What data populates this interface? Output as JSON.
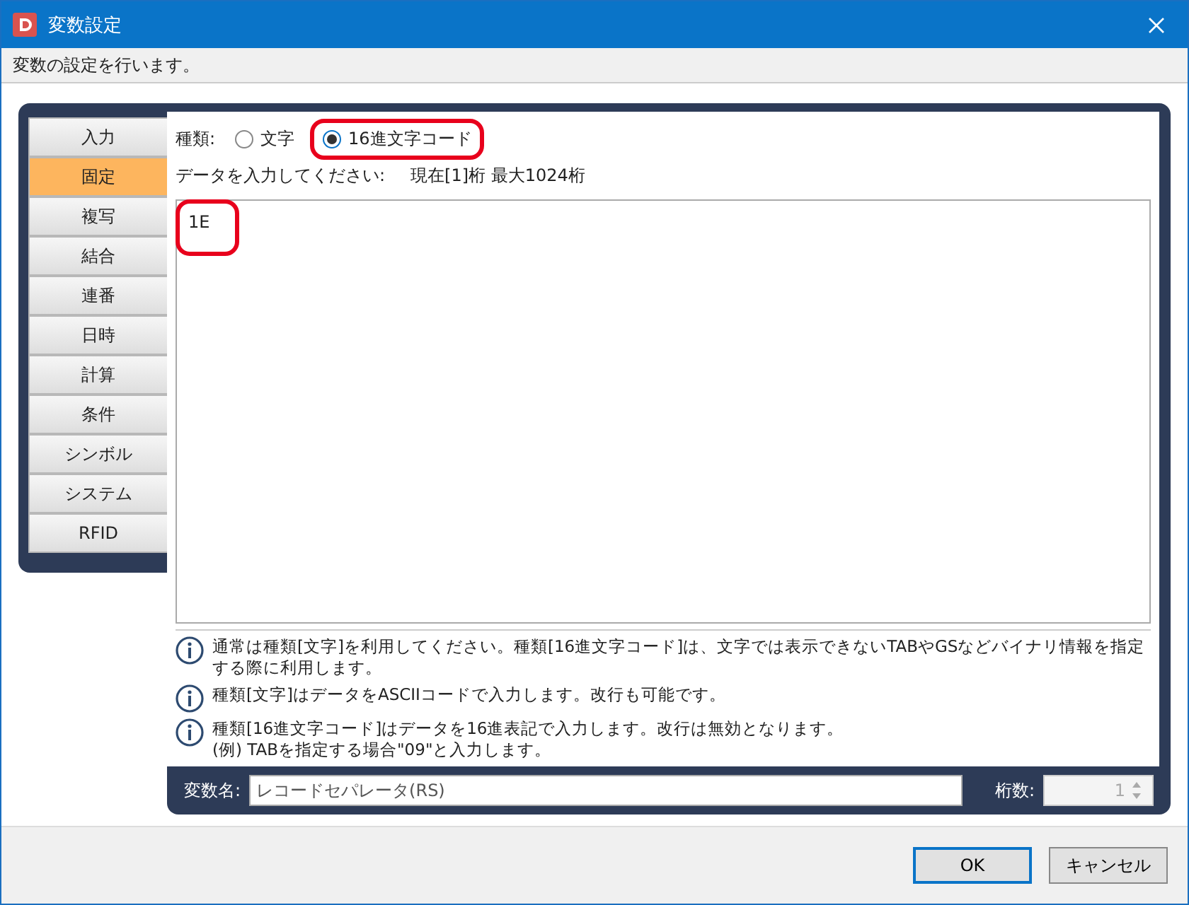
{
  "window": {
    "title": "変数設定",
    "description": "変数の設定を行います。"
  },
  "tabs": [
    {
      "label": "入力",
      "selected": false
    },
    {
      "label": "固定",
      "selected": true
    },
    {
      "label": "複写",
      "selected": false
    },
    {
      "label": "結合",
      "selected": false
    },
    {
      "label": "連番",
      "selected": false
    },
    {
      "label": "日時",
      "selected": false
    },
    {
      "label": "計算",
      "selected": false
    },
    {
      "label": "条件",
      "selected": false
    },
    {
      "label": "シンボル",
      "selected": false
    },
    {
      "label": "システム",
      "selected": false
    },
    {
      "label": "RFID",
      "selected": false
    }
  ],
  "type": {
    "label": "種類:",
    "options": [
      {
        "label": "文字",
        "selected": false,
        "highlighted": false
      },
      {
        "label": "16進文字コード",
        "selected": true,
        "highlighted": true
      }
    ]
  },
  "data": {
    "prompt": "データを入力してください:",
    "status": "現在[1]桁 最大1024桁",
    "value": "1E",
    "highlighted": true
  },
  "notes": [
    {
      "lines": [
        "通常は種類[文字]を利用してください。種類[16進文字コード]は、文字では表示できないTABやGSなどバイナリ情報を指定する際に利用します。"
      ]
    },
    {
      "lines": [
        "種類[文字]はデータをASCIIコードで入力します。改行も可能です。"
      ]
    },
    {
      "lines": [
        "種類[16進文字コード]はデータを16進表記で入力します。改行は無効となります。",
        "(例) TABを指定する場合\"09\"と入力します。"
      ]
    }
  ],
  "variable_name": {
    "label": "変数名:",
    "value": "レコードセパレータ(RS)"
  },
  "digits": {
    "label": "桁数:",
    "value": "1",
    "disabled": true
  },
  "buttons": [
    {
      "label": "OK",
      "default": true
    },
    {
      "label": "キャンセル",
      "default": false
    }
  ]
}
